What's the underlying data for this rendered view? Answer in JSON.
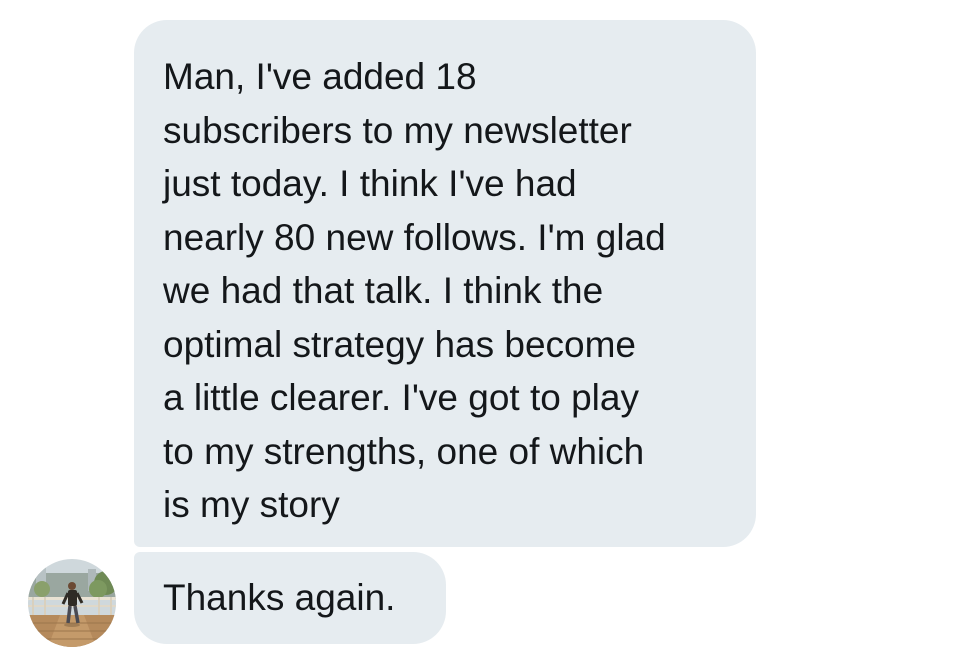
{
  "conversation": {
    "messages": [
      {
        "lines": [
          "Man, I've added 18",
          "subscribers to my newsletter",
          "just today. I think I've had",
          "nearly 80 new follows. I'm glad",
          "we had that talk. I think the",
          "optimal strategy has become",
          "a little clearer. I've got to play",
          "to my strengths, one of which",
          "is my story"
        ]
      },
      {
        "lines": [
          "Thanks again."
        ]
      }
    ],
    "bubble_color": "#e6ecf0",
    "text_color": "#14171a",
    "avatar_icon": "user-avatar-photo"
  }
}
